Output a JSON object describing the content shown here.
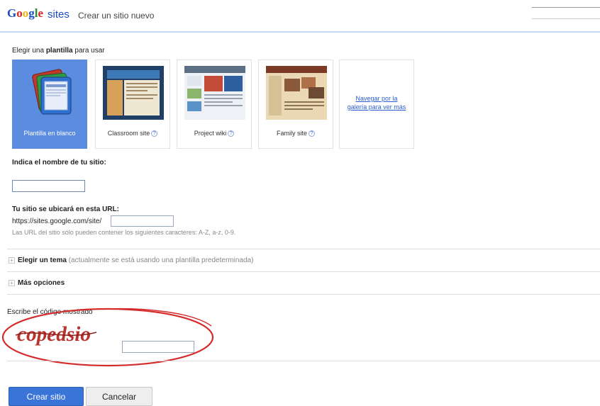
{
  "header": {
    "logo_google": "Google",
    "logo_sites": "sites",
    "page_title": "Crear un sitio nuevo"
  },
  "templates": {
    "heading_prefix": "Elegir una ",
    "heading_bold": "plantilla",
    "heading_suffix": " para usar",
    "items": [
      {
        "label": "Plantilla en blanco",
        "selected": true
      },
      {
        "label": "Classroom site",
        "help_icon": "?"
      },
      {
        "label": "Project wiki",
        "help_icon": "?"
      },
      {
        "label": "Family site",
        "help_icon": "?"
      }
    ],
    "gallery_link": "Navegar por la galería para ver más"
  },
  "site_name": {
    "label_prefix": "Indica el ",
    "label_bold": "nombre",
    "label_suffix": " de tu sitio:",
    "value": ""
  },
  "site_url": {
    "label": "Tu sitio se ubicará en esta URL:",
    "prefix": "https://sites.google.com/site/",
    "value": "",
    "hint": "Las URL del sitio sólo pueden contener los siguientes caracteres: A-Z, a-z, 0-9."
  },
  "theme": {
    "expand_icon": "+",
    "title": "Elegir un tema",
    "note": " (actualmente se está usando una plantilla predeterminada)"
  },
  "more_options": {
    "expand_icon": "+",
    "title": "Más opciones"
  },
  "captcha": {
    "label": "Escribe el código mostrado",
    "image_text": "copedsio",
    "value": ""
  },
  "buttons": {
    "create": "Crear sitio",
    "cancel": "Cancelar"
  },
  "colors": {
    "primary_button": "#3a74d8",
    "selected_template": "#5b8ce0",
    "annotation_ellipse": "#d42a2a",
    "captcha_text": "#b8322e"
  }
}
